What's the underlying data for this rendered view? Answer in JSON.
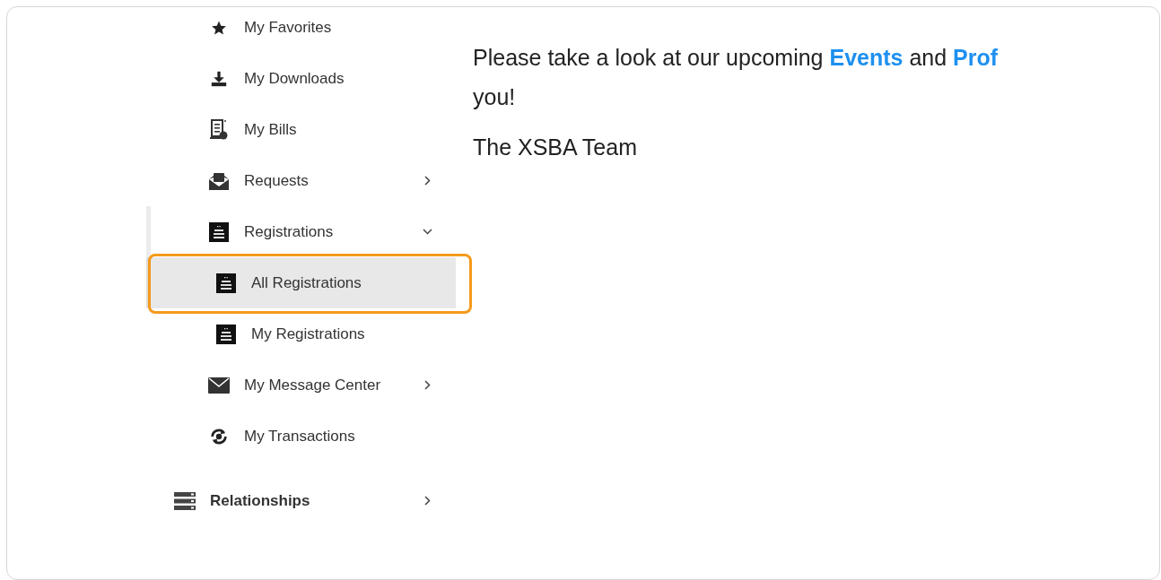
{
  "sidebar": {
    "nested_items": [
      {
        "label": "My Favorites",
        "selected": false
      },
      {
        "label": "My Downloads",
        "selected": false
      },
      {
        "label": "My Bills",
        "selected": false
      },
      {
        "label": "Requests",
        "selected": false,
        "expanded": false
      },
      {
        "label": "Registrations",
        "selected": false,
        "expanded": true,
        "children": [
          {
            "label": "All Registrations",
            "selected": true
          },
          {
            "label": "My Registrations",
            "selected": false
          }
        ]
      },
      {
        "label": "My Message Center",
        "selected": false,
        "expanded": false
      },
      {
        "label": "My Transactions",
        "selected": false
      }
    ],
    "items": [
      {
        "label": "Relationships",
        "selected": false,
        "expanded": false
      }
    ]
  },
  "message": {
    "line_1": [
      {
        "kind": "text",
        "text": "Please take a look at our upcoming "
      },
      {
        "kind": "link",
        "text": "Events"
      },
      {
        "kind": "text",
        "text": " and "
      },
      {
        "kind": "link",
        "text": "Prof"
      }
    ],
    "line_2": "you!",
    "signature": "The XSBA Team"
  }
}
